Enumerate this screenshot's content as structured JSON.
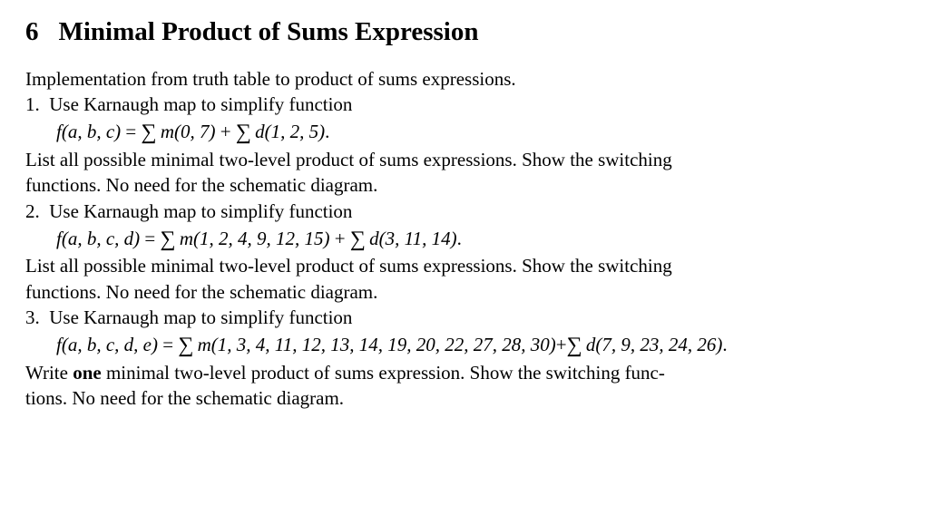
{
  "section_number": "6",
  "section_title": "Minimal Product of Sums Expression",
  "intro": "Implementation from truth table to product of sums expressions.",
  "q1": {
    "num": "1.",
    "lead": "Use Karnaugh map to simplify function",
    "fn_lhs": "f(a, b, c)",
    "mlist": "m(0, 7)",
    "dlist": "d(1, 2, 5)",
    "tail_a": "List all possible minimal two-level product of sums expressions.  Show the switching",
    "tail_b": "functions.  No need for the schematic diagram."
  },
  "q2": {
    "num": "2.",
    "lead": "Use Karnaugh map to simplify function",
    "fn_lhs": "f(a, b, c, d)",
    "mlist": "m(1, 2, 4, 9, 12, 15)",
    "dlist": "d(3, 11, 14)",
    "tail_a": "List all possible minimal two-level product of sums expressions.  Show the switching",
    "tail_b": "functions.  No need for the schematic diagram."
  },
  "q3": {
    "num": "3.",
    "lead": "Use Karnaugh map to simplify function",
    "fn_lhs": "f(a, b, c, d, e)",
    "mlist": "m(1, 3, 4, 11, 12, 13, 14, 19, 20, 22, 27, 28, 30)",
    "dlist": "d(7, 9, 23, 24, 26)",
    "tail_a": "Write ",
    "tail_bold": "one",
    "tail_a2": " minimal two-level product of sums expression.  Show the switching func-",
    "tail_b": "tions.  No need for the schematic diagram."
  },
  "sym": {
    "sigma": "∑",
    "eq": " = ",
    "plus": " + ",
    "dot": "."
  }
}
